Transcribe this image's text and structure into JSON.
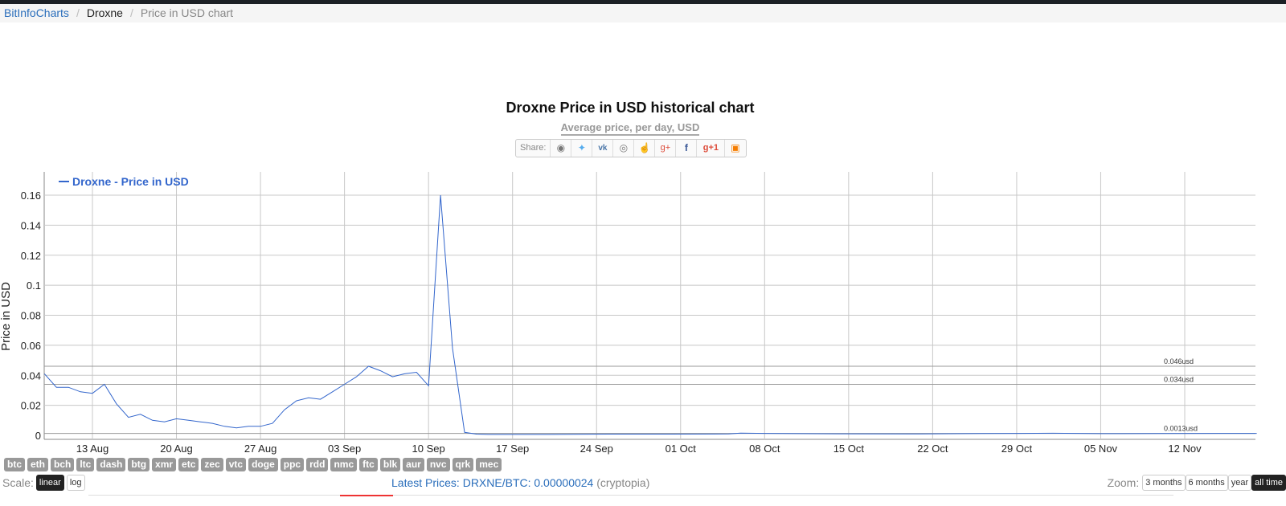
{
  "breadcrumb": {
    "home": "BitInfoCharts",
    "coin": "Droxne",
    "page": "Price in USD chart"
  },
  "share": {
    "label": "Share:"
  },
  "chart_data": {
    "type": "line",
    "title": "Droxne Price in USD historical chart",
    "subtitle": "Average price, per day, USD",
    "ylabel": "Price in USD",
    "xlabel": "",
    "ylim": [
      0,
      0.16
    ],
    "yticks": [
      "0.16",
      "0.14",
      "0.12",
      "0.1",
      "0.08",
      "0.06",
      "0.04",
      "0.02",
      "0"
    ],
    "xticks": [
      "13 Aug",
      "20 Aug",
      "27 Aug",
      "03 Sep",
      "10 Sep",
      "17 Sep",
      "24 Sep",
      "01 Oct",
      "08 Oct",
      "15 Oct",
      "22 Oct",
      "29 Oct",
      "05 Nov",
      "12 Nov"
    ],
    "legend": "top-left",
    "grid": true,
    "series": [
      {
        "name": "Droxne - Price in USD",
        "color": "#3366cc",
        "points": [
          [
            "2017-08-09",
            0.041
          ],
          [
            "2017-08-10",
            0.032
          ],
          [
            "2017-08-11",
            0.032
          ],
          [
            "2017-08-12",
            0.029
          ],
          [
            "2017-08-13",
            0.028
          ],
          [
            "2017-08-14",
            0.034
          ],
          [
            "2017-08-15",
            0.021
          ],
          [
            "2017-08-16",
            0.012
          ],
          [
            "2017-08-17",
            0.014
          ],
          [
            "2017-08-18",
            0.01
          ],
          [
            "2017-08-19",
            0.009
          ],
          [
            "2017-08-20",
            0.011
          ],
          [
            "2017-08-21",
            0.01
          ],
          [
            "2017-08-22",
            0.009
          ],
          [
            "2017-08-23",
            0.008
          ],
          [
            "2017-08-24",
            0.006
          ],
          [
            "2017-08-25",
            0.005
          ],
          [
            "2017-08-26",
            0.006
          ],
          [
            "2017-08-27",
            0.006
          ],
          [
            "2017-08-28",
            0.008
          ],
          [
            "2017-08-29",
            0.017
          ],
          [
            "2017-08-30",
            0.023
          ],
          [
            "2017-08-31",
            0.025
          ],
          [
            "2017-09-01",
            0.024
          ],
          [
            "2017-09-02",
            0.029
          ],
          [
            "2017-09-03",
            0.034
          ],
          [
            "2017-09-04",
            0.039
          ],
          [
            "2017-09-05",
            0.046
          ],
          [
            "2017-09-06",
            0.043
          ],
          [
            "2017-09-07",
            0.039
          ],
          [
            "2017-09-08",
            0.041
          ],
          [
            "2017-09-09",
            0.042
          ],
          [
            "2017-09-10",
            0.033
          ],
          [
            "2017-09-11",
            0.16
          ],
          [
            "2017-09-12",
            0.058
          ],
          [
            "2017-09-13",
            0.002
          ],
          [
            "2017-09-14",
            0.0008
          ],
          [
            "2017-09-15",
            0.0006
          ],
          [
            "2017-09-20",
            0.0006
          ],
          [
            "2017-09-25",
            0.0008
          ],
          [
            "2017-09-30",
            0.0008
          ],
          [
            "2017-10-05",
            0.0009
          ],
          [
            "2017-10-06",
            0.0015
          ],
          [
            "2017-10-08",
            0.0013
          ],
          [
            "2017-10-14",
            0.001
          ],
          [
            "2017-10-20",
            0.0009
          ],
          [
            "2017-10-26",
            0.0012
          ],
          [
            "2017-11-01",
            0.0014
          ],
          [
            "2017-11-05",
            0.0011
          ],
          [
            "2017-11-10",
            0.0012
          ],
          [
            "2017-11-15",
            0.0013
          ],
          [
            "2017-11-18",
            0.0013
          ]
        ]
      }
    ],
    "annotations": [
      {
        "label": "0.046usd",
        "value": 0.046
      },
      {
        "label": "0.034usd",
        "value": 0.034
      },
      {
        "label": "0.0013usd",
        "value": 0.0013
      }
    ]
  },
  "coin_tags": [
    "btc",
    "eth",
    "bch",
    "ltc",
    "dash",
    "btg",
    "xmr",
    "etc",
    "zec",
    "vtc",
    "doge",
    "ppc",
    "rdd",
    "nmc",
    "ftc",
    "blk",
    "aur",
    "nvc",
    "qrk",
    "mec"
  ],
  "scale": {
    "label": "Scale:",
    "options": [
      "linear",
      "log"
    ],
    "active": "linear"
  },
  "latest": {
    "text": "Latest Prices: DRXNE/BTC: 0.00000024",
    "source": "(cryptopia)"
  },
  "zoom": {
    "label": "Zoom:",
    "options": [
      "3 months",
      "6 months",
      "year",
      "all time"
    ],
    "active": "all time"
  },
  "colors": {
    "line": "#3366cc",
    "grid": "#c8c8c8",
    "link": "#2a6ebb"
  }
}
